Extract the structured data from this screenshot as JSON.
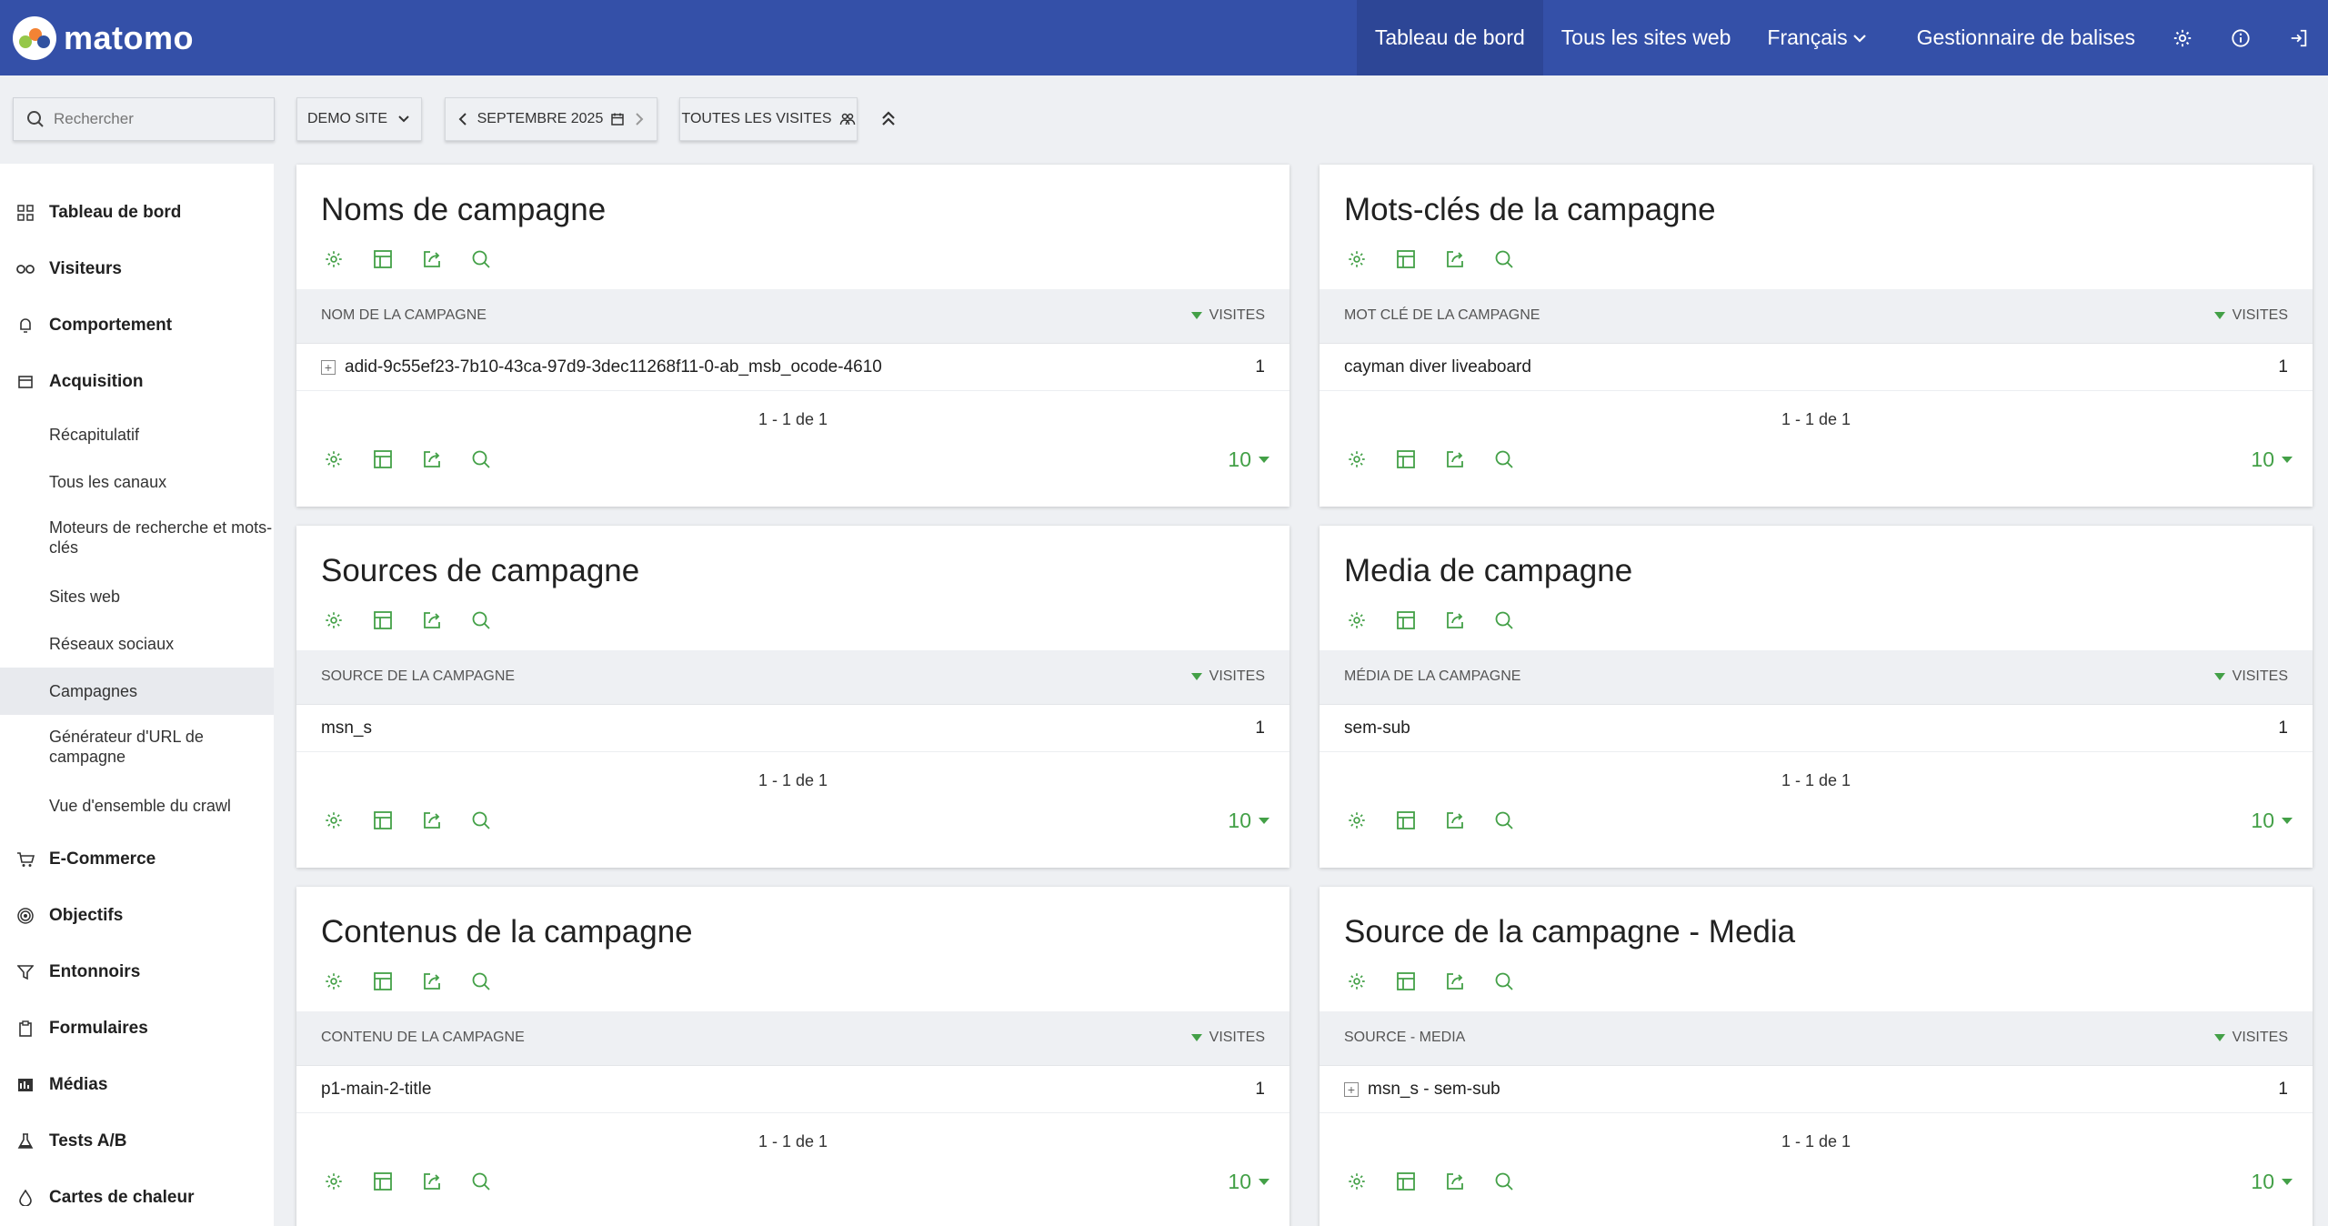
{
  "app": {
    "name": "matomo"
  },
  "topnav": {
    "items": [
      {
        "label": "Tableau de bord"
      },
      {
        "label": "Tous les sites web"
      },
      {
        "label": "Français"
      },
      {
        "label": "Gestionnaire de balises"
      }
    ]
  },
  "search": {
    "placeholder": "Rechercher"
  },
  "controls": {
    "site": "DEMO SITE",
    "date": "SEPTEMBRE 2025",
    "segment": "TOUTES LES VISITES"
  },
  "sidebar": {
    "categories": [
      {
        "label": "Tableau de bord",
        "icon": "dashboard-icon"
      },
      {
        "label": "Visiteurs",
        "icon": "visitors-icon"
      },
      {
        "label": "Comportement",
        "icon": "behaviour-icon"
      },
      {
        "label": "Acquisition",
        "icon": "acquisition-icon"
      },
      {
        "label": "E-Commerce",
        "icon": "cart-icon"
      },
      {
        "label": "Objectifs",
        "icon": "goals-icon"
      },
      {
        "label": "Entonnoirs",
        "icon": "funnel-icon"
      },
      {
        "label": "Formulaires",
        "icon": "forms-icon"
      },
      {
        "label": "Médias",
        "icon": "media-icon"
      },
      {
        "label": "Tests A/B",
        "icon": "flask-icon"
      },
      {
        "label": "Cartes de chaleur",
        "icon": "heatmap-icon"
      }
    ],
    "acquisition_items": [
      {
        "label": "Récapitulatif"
      },
      {
        "label": "Tous les canaux"
      },
      {
        "label": "Moteurs de recherche et mots-clés"
      },
      {
        "label": "Sites web"
      },
      {
        "label": "Réseaux sociaux"
      },
      {
        "label": "Campagnes",
        "active": true
      },
      {
        "label": "Générateur d'URL de campagne"
      },
      {
        "label": "Vue d'ensemble du crawl"
      }
    ]
  },
  "widgets": [
    {
      "title": "Noms de campagne",
      "col_label": "NOM DE LA CAMPAGNE",
      "col_metric": "VISITES",
      "row_label": "adid-9c55ef23-7b10-43ca-97d9-3dec11268f11-0-ab_msb_ocode-4610",
      "row_value": "1",
      "row_expandable": true,
      "pager": "1 - 1 de 1",
      "limit": "10"
    },
    {
      "title": "Mots-clés de la campagne",
      "col_label": "MOT CLÉ DE LA CAMPAGNE",
      "col_metric": "VISITES",
      "row_label": "cayman diver liveaboard",
      "row_value": "1",
      "row_expandable": false,
      "pager": "1 - 1 de 1",
      "limit": "10"
    },
    {
      "title": "Sources de campagne",
      "col_label": "SOURCE DE LA CAMPAGNE",
      "col_metric": "VISITES",
      "row_label": "msn_s",
      "row_value": "1",
      "row_expandable": false,
      "pager": "1 - 1 de 1",
      "limit": "10"
    },
    {
      "title": "Media de campagne",
      "col_label": "MÉDIA DE LA CAMPAGNE",
      "col_metric": "VISITES",
      "row_label": "sem-sub",
      "row_value": "1",
      "row_expandable": false,
      "pager": "1 - 1 de 1",
      "limit": "10"
    },
    {
      "title": "Contenus de la campagne",
      "col_label": "CONTENU DE LA CAMPAGNE",
      "col_metric": "VISITES",
      "row_label": "p1-main-2-title",
      "row_value": "1",
      "row_expandable": false,
      "pager": "1 - 1 de 1",
      "limit": "10"
    },
    {
      "title": "Source de la campagne - Media",
      "col_label": "SOURCE - MEDIA",
      "col_metric": "VISITES",
      "row_label": "msn_s - sem-sub",
      "row_value": "1",
      "row_expandable": true,
      "pager": "1 - 1 de 1",
      "limit": "10"
    }
  ],
  "colors": {
    "header": "#3450a8",
    "header_active": "#2d4696",
    "accent_green": "#43a047"
  }
}
